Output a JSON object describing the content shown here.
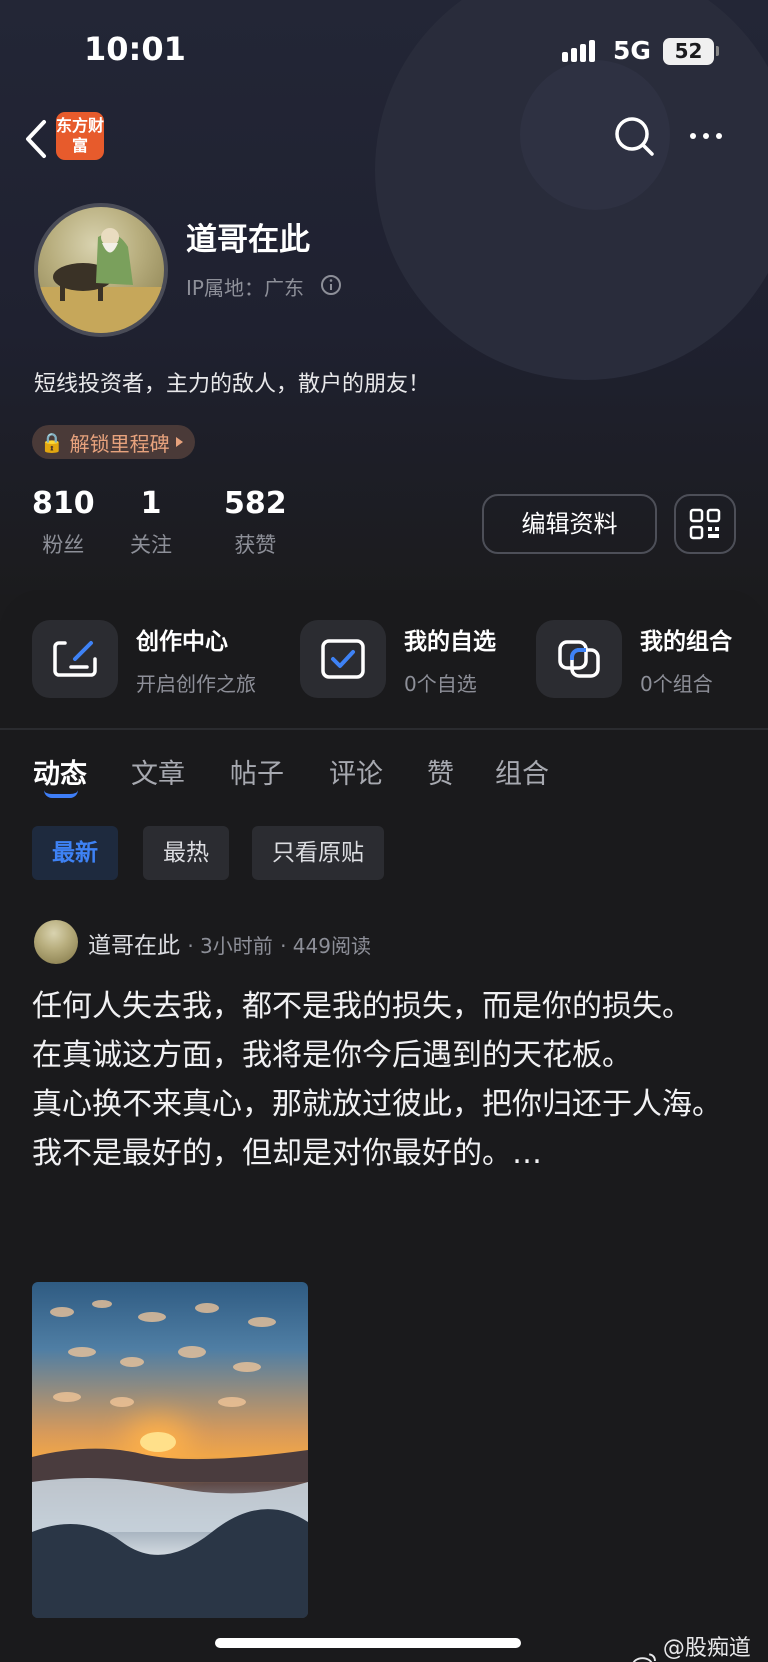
{
  "status_bar": {
    "time": "10:01",
    "network": "5G",
    "battery": "52"
  },
  "nav": {
    "app_logo_text": "东方财富"
  },
  "profile": {
    "username": "道哥在此",
    "ip_location": "IP属地：广东",
    "bio": "短线投资者，主力的敌人，散户的朋友！",
    "milestone_label": "解锁里程碑",
    "stats": [
      {
        "value": "810",
        "label": "粉丝"
      },
      {
        "value": "1",
        "label": "关注"
      },
      {
        "value": "582",
        "label": "获赞"
      }
    ],
    "edit_label": "编辑资料"
  },
  "shortcuts": [
    {
      "title": "创作中心",
      "subtitle": "开启创作之旅"
    },
    {
      "title": "我的自选",
      "subtitle": "0个自选"
    },
    {
      "title": "我的组合",
      "subtitle": "0个组合"
    }
  ],
  "tabs": [
    "动态",
    "文章",
    "帖子",
    "评论",
    "赞",
    "组合"
  ],
  "filters": [
    "最新",
    "最热",
    "只看原贴"
  ],
  "post": {
    "author": "道哥在此",
    "time": "3小时前",
    "reads": "449阅读",
    "lines": [
      "任何人失去我，都不是我的损失，而是你的损失。",
      "在真诚这方面，我将是你今后遇到的天花板。",
      "真心换不来真心，那就放过彼此，把你归还于人海。",
      "我不是最好的，但却是对你最好的。…"
    ]
  },
  "watermark": "@股痴道哥"
}
